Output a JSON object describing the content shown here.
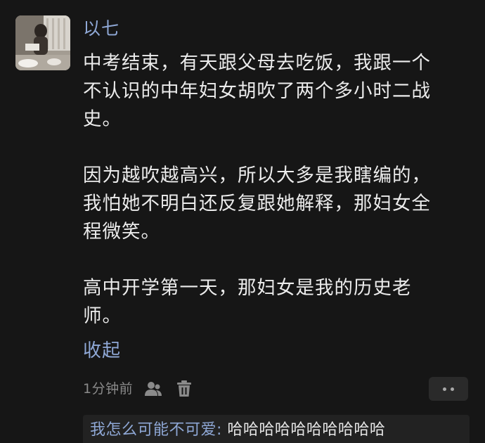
{
  "comment": {
    "username": "以七",
    "paragraphs": [
      [
        "中考结束，有天跟父母去吃饭，我跟一个",
        "不认识的中年妇女胡吹了两个多小时二战",
        "史。"
      ],
      [
        "因为越吹越高兴，所以大多是我瞎编的，",
        "我怕她不明白还反复跟她解释，那妇女全",
        "程微笑。"
      ],
      [
        "高中开学第一天，那妇女是我的历史老",
        "师。"
      ]
    ],
    "collapse_label": "收起",
    "time": "1分钟前",
    "icons": {
      "user": "user-icon",
      "delete": "trash-icon",
      "more": "more-dots-icon"
    }
  },
  "reply": {
    "user": "我怎么可能不可爱:",
    "text": " 哈哈哈哈哈哈哈哈哈哈"
  },
  "colors": {
    "background": "#161616",
    "link": "#8fa8d6",
    "text": "#ececec",
    "meta": "#8a8a8a",
    "reply_bg": "#222222"
  }
}
